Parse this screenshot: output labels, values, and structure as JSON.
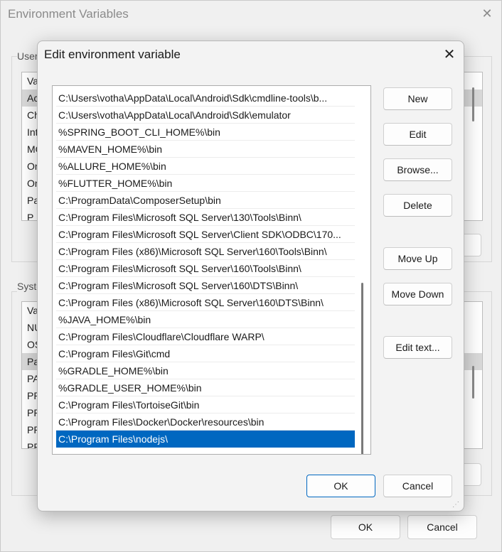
{
  "background_window": {
    "title": "Environment Variables",
    "close_glyph": "✕",
    "user_group_label": "User",
    "user_rows": [
      "Va",
      "Ac",
      "Ch",
      "Int",
      "MC",
      "On",
      "On",
      "Pa",
      "P"
    ],
    "system_group_label": "Syste",
    "system_rows": [
      "Va",
      "NU",
      "OS",
      "Pa",
      "PA",
      "PR",
      "PR",
      "PR",
      "PR"
    ],
    "ok_label": "OK",
    "cancel_label": "Cancel"
  },
  "dialog": {
    "title": "Edit environment variable",
    "close_glyph": "✕",
    "paths": [
      "C:\\Users\\votha\\AppData\\Local\\Android\\Sdk\\cmdline-tools\\b...",
      "C:\\Users\\votha\\AppData\\Local\\Android\\Sdk\\emulator",
      "%SPRING_BOOT_CLI_HOME%\\bin",
      "%MAVEN_HOME%\\bin",
      "%ALLURE_HOME%\\bin",
      "%FLUTTER_HOME%\\bin",
      "C:\\ProgramData\\ComposerSetup\\bin",
      "C:\\Program Files\\Microsoft SQL Server\\130\\Tools\\Binn\\",
      "C:\\Program Files\\Microsoft SQL Server\\Client SDK\\ODBC\\170...",
      "C:\\Program Files (x86)\\Microsoft SQL Server\\160\\Tools\\Binn\\",
      "C:\\Program Files\\Microsoft SQL Server\\160\\Tools\\Binn\\",
      "C:\\Program Files\\Microsoft SQL Server\\160\\DTS\\Binn\\",
      "C:\\Program Files (x86)\\Microsoft SQL Server\\160\\DTS\\Binn\\",
      "%JAVA_HOME%\\bin",
      "C:\\Program Files\\Cloudflare\\Cloudflare WARP\\",
      "C:\\Program Files\\Git\\cmd",
      "%GRADLE_HOME%\\bin",
      "%GRADLE_USER_HOME%\\bin",
      "C:\\Program Files\\TortoiseGit\\bin",
      "C:\\Program Files\\Docker\\Docker\\resources\\bin",
      "C:\\Program Files\\nodejs\\"
    ],
    "selected_index": 20,
    "buttons": {
      "new": "New",
      "edit": "Edit",
      "browse": "Browse...",
      "delete": "Delete",
      "move_up": "Move Up",
      "move_down": "Move Down",
      "edit_text": "Edit text..."
    },
    "ok_label": "OK",
    "cancel_label": "Cancel",
    "resize_glyph": "⋰"
  },
  "colors": {
    "selection": "#0067c0",
    "accent_border": "#0067c0"
  }
}
